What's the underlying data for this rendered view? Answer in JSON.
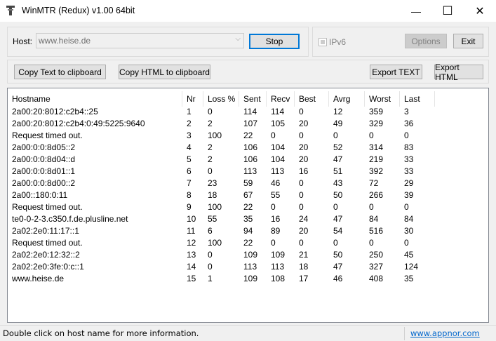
{
  "window": {
    "title": "WinMTR (Redux) v1.00 64bit",
    "minimize": "—",
    "maximize": "☐",
    "close": "✕"
  },
  "host": {
    "label": "Host:",
    "value": "www.heise.de"
  },
  "buttons": {
    "stop": "Stop",
    "options": "Options",
    "exit": "Exit",
    "copy_text": "Copy Text to clipboard",
    "copy_html": "Copy HTML to clipboard",
    "export_text": "Export TEXT",
    "export_html": "Export HTML"
  },
  "ipv6": {
    "label": "IPv6",
    "checked": false
  },
  "table": {
    "columns": [
      "Hostname",
      "Nr",
      "Loss %",
      "Sent",
      "Recv",
      "Best",
      "Avrg",
      "Worst",
      "Last"
    ],
    "rows": [
      [
        "2a00:20:8012:c2b4::25",
        "1",
        "0",
        "114",
        "114",
        "0",
        "12",
        "359",
        "3"
      ],
      [
        "2a00:20:8012:c2b4:0:49:5225:9640",
        "2",
        "2",
        "107",
        "105",
        "20",
        "49",
        "329",
        "36"
      ],
      [
        "Request timed out.",
        "3",
        "100",
        "22",
        "0",
        "0",
        "0",
        "0",
        "0"
      ],
      [
        "2a00:0:0:8d05::2",
        "4",
        "2",
        "106",
        "104",
        "20",
        "52",
        "314",
        "83"
      ],
      [
        "2a00:0:0:8d04::d",
        "5",
        "2",
        "106",
        "104",
        "20",
        "47",
        "219",
        "33"
      ],
      [
        "2a00:0:0:8d01::1",
        "6",
        "0",
        "113",
        "113",
        "16",
        "51",
        "392",
        "33"
      ],
      [
        "2a00:0:0:8d00::2",
        "7",
        "23",
        "59",
        "46",
        "0",
        "43",
        "72",
        "29"
      ],
      [
        "2a00::180:0:11",
        "8",
        "18",
        "67",
        "55",
        "0",
        "50",
        "266",
        "39"
      ],
      [
        "Request timed out.",
        "9",
        "100",
        "22",
        "0",
        "0",
        "0",
        "0",
        "0"
      ],
      [
        "te0-0-2-3.c350.f.de.plusline.net",
        "10",
        "55",
        "35",
        "16",
        "24",
        "47",
        "84",
        "84"
      ],
      [
        "2a02:2e0:11:17::1",
        "11",
        "6",
        "94",
        "89",
        "20",
        "54",
        "516",
        "30"
      ],
      [
        "Request timed out.",
        "12",
        "100",
        "22",
        "0",
        "0",
        "0",
        "0",
        "0"
      ],
      [
        "2a02:2e0:12:32::2",
        "13",
        "0",
        "109",
        "109",
        "21",
        "50",
        "250",
        "45"
      ],
      [
        "2a02:2e0:3fe:0:c::1",
        "14",
        "0",
        "113",
        "113",
        "18",
        "47",
        "327",
        "124"
      ],
      [
        "www.heise.de",
        "15",
        "1",
        "109",
        "108",
        "17",
        "46",
        "408",
        "35"
      ]
    ]
  },
  "status": {
    "text": "Double click on host name for more information.",
    "link": "www.appnor.com"
  },
  "colors": {
    "link": "#0066cc",
    "focus": "#0078d7"
  }
}
